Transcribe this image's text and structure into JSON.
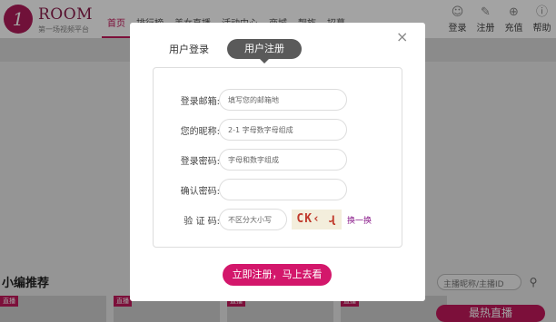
{
  "site": {
    "logo_mark": "1",
    "name": "ROOM",
    "tagline": "第一场视频平台"
  },
  "nav": {
    "items": [
      "首页",
      "排行榜",
      "美女直播",
      "活动中心",
      "商城",
      "靓族",
      "招募"
    ]
  },
  "user_actions": {
    "login": "登录",
    "register": "注册",
    "recharge": "充值",
    "help": "帮助"
  },
  "background": {
    "section_title": "小编推荐",
    "search_placeholder": "主播昵称/主播ID",
    "badge": "直播",
    "hot_button": "最热直播"
  },
  "modal": {
    "tab_login": "用户登录",
    "tab_register": "用户注册",
    "close_symbol": "×",
    "fields": {
      "email": {
        "label": "登录邮箱:",
        "placeholder": "填写您的邮箱地"
      },
      "nickname": {
        "label": "您的昵称:",
        "placeholder": "2-1             字母数字母组成"
      },
      "password": {
        "label": "登录密码:",
        "placeholder": "       字母和数字组成"
      },
      "confirm": {
        "label": "确认密码:",
        "placeholder": ""
      },
      "captcha": {
        "label": "验  证  码:",
        "placeholder": "不区分大小写",
        "image_text": "CK‹ ɻ",
        "refresh": "换一换"
      }
    },
    "submit": "立即注册，马上去看"
  }
}
